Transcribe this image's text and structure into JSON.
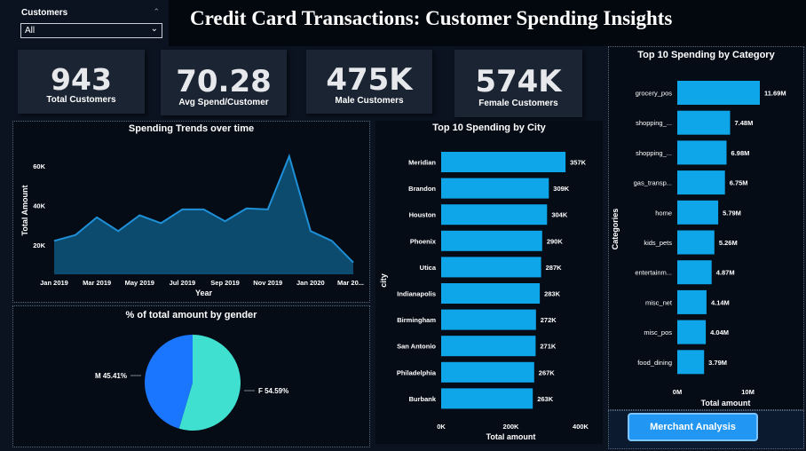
{
  "filter": {
    "label": "Customers",
    "value": "All"
  },
  "header": {
    "title": "Credit Card Transactions: Customer Spending Insights"
  },
  "kpis": [
    {
      "value": "943",
      "label": "Total Customers"
    },
    {
      "value": "70.28",
      "label": "Avg Spend/Customer"
    },
    {
      "value": "475K",
      "label": "Male Customers"
    },
    {
      "value": "574K",
      "label": "Female Customers"
    }
  ],
  "button": {
    "label": "Merchant Analysis"
  },
  "colors": {
    "bar": "#0ea5e9",
    "area_fill": "#0c4a6e",
    "area_line": "#1e90d8",
    "pie_m": "#1a75ff",
    "pie_f": "#40e0d0",
    "button": "#2196f3"
  },
  "chart_data": [
    {
      "type": "area",
      "title": "Spending Trends over time",
      "xlabel": "Year",
      "ylabel": "Total Amount",
      "x": [
        "Jan 2019",
        "Feb 2019",
        "Mar 2019",
        "Apr 2019",
        "May 2019",
        "Jun 2019",
        "Jul 2019",
        "Aug 2019",
        "Sep 2019",
        "Oct 2019",
        "Nov 2019",
        "Dec 2019",
        "Jan 2020",
        "Feb 2020",
        "Mar 2020"
      ],
      "tick_labels": [
        "Jan 2019",
        "Mar 2019",
        "May 2019",
        "Jul 2019",
        "Sep 2019",
        "Nov 2019",
        "Jan 2020",
        "Mar 20..."
      ],
      "y_tick_labels": [
        "20K",
        "40K",
        "60K"
      ],
      "values": [
        22000,
        25000,
        34000,
        27000,
        35000,
        31000,
        38000,
        38000,
        32000,
        38500,
        38000,
        65000,
        27000,
        22000,
        11000
      ],
      "ylim": [
        5000,
        70000
      ]
    },
    {
      "type": "bar",
      "orientation": "horizontal",
      "title": "Top 10 Spending by City",
      "xlabel": "Total amount",
      "ylabel": "city",
      "categories": [
        "Meridian",
        "Brandon",
        "Houston",
        "Phoenix",
        "Utica",
        "Indianapolis",
        "Birmingham",
        "San Antonio",
        "Philadelphia",
        "Burbank"
      ],
      "values": [
        357000,
        309000,
        304000,
        290000,
        287000,
        283000,
        272000,
        271000,
        267000,
        263000
      ],
      "value_labels": [
        "357K",
        "309K",
        "304K",
        "290K",
        "287K",
        "283K",
        "272K",
        "271K",
        "267K",
        "263K"
      ],
      "x_tick_labels": [
        "0K",
        "200K",
        "400K"
      ],
      "xlim": [
        0,
        400000
      ]
    },
    {
      "type": "pie",
      "title": "% of total amount by gender",
      "slices": [
        {
          "label": "F 54.59%",
          "value": 54.59
        },
        {
          "label": "M 45.41%",
          "value": 45.41
        }
      ]
    },
    {
      "type": "bar",
      "orientation": "horizontal",
      "title": "Top 10 Spending by Category",
      "xlabel": "Total amount",
      "ylabel": "Categories",
      "categories": [
        "grocery_pos",
        "shopping_...",
        "shopping_...",
        "gas_transp...",
        "home",
        "kids_pets",
        "entertainm...",
        "misc_net",
        "misc_pos",
        "food_dining"
      ],
      "values": [
        11.69,
        7.48,
        6.98,
        6.75,
        5.79,
        5.26,
        4.87,
        4.14,
        4.04,
        3.79
      ],
      "value_labels": [
        "11.69M",
        "7.48M",
        "6.98M",
        "6.75M",
        "5.79M",
        "5.26M",
        "4.87M",
        "4.14M",
        "4.04M",
        "3.79M"
      ],
      "x_tick_labels": [
        "0M",
        "10M"
      ],
      "xlim": [
        0,
        13.7
      ]
    }
  ]
}
